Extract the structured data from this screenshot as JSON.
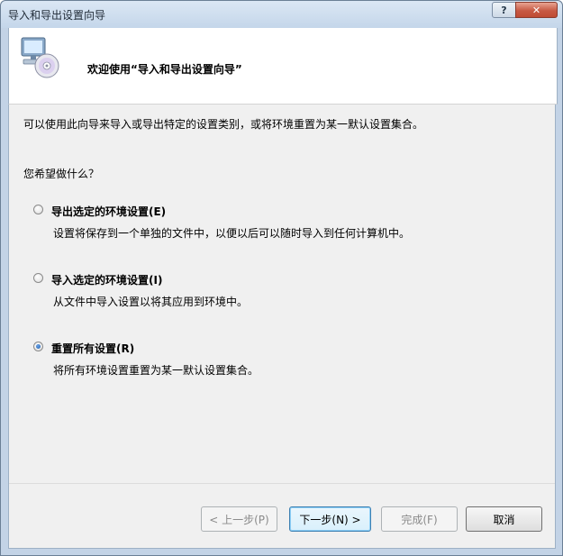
{
  "window": {
    "title": "导入和导出设置向导",
    "help_label": "?",
    "close_label": "✕"
  },
  "header": {
    "icon": "computer-cd-icon",
    "title": "欢迎使用“导入和导出设置向导”"
  },
  "content": {
    "description": "可以使用此向导来导入或导出特定的设置类别，或将环境重置为某一默认设置集合。",
    "question": "您希望做什么？",
    "options": [
      {
        "label": "导出选定的环境设置(E)",
        "description": "设置将保存到一个单独的文件中，以便以后可以随时导入到任何计算机中。",
        "selected": false
      },
      {
        "label": "导入选定的环境设置(I)",
        "description": "从文件中导入设置以将其应用到环境中。",
        "selected": false
      },
      {
        "label": "重置所有设置(R)",
        "description": "将所有环境设置重置为某一默认设置集合。",
        "selected": true
      }
    ]
  },
  "buttons": {
    "previous": "< 上一步(P)",
    "next": "下一步(N) >",
    "finish": "完成(F)",
    "cancel": "取消"
  }
}
